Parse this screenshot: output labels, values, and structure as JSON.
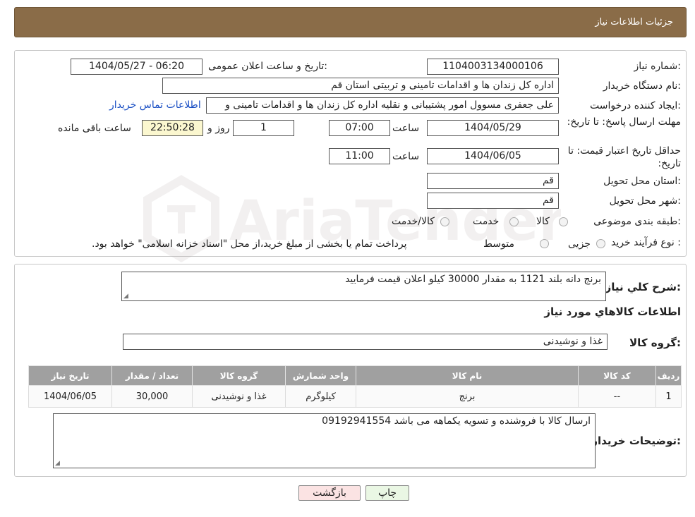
{
  "header": {
    "title": "جزئیات اطلاعات نیاز"
  },
  "form": {
    "need_number_label": "شماره نیاز:",
    "need_number": "1104003134000106",
    "announce_label": "تاریخ و ساعت اعلان عمومی:",
    "announce_value": "1404/05/27 - 06:20",
    "buyer_org_label": "نام دستگاه خریدار:",
    "buyer_org": "اداره کل زندان ها و اقدامات تامینی و تربیتی استان قم",
    "requester_label": "ایجاد کننده درخواست:",
    "requester": "علی جعفری مسوول امور پشتیبانی و نقلیه اداره کل زندان ها و اقدامات تامینی و",
    "contact_link": "اطلاعات تماس خریدار",
    "reply_deadline_label": "مهلت ارسال پاسخ: تا تاریخ:",
    "reply_date": "1404/05/29",
    "time_label": "ساعت",
    "reply_time": "07:00",
    "days_value": "1",
    "days_label": "روز و",
    "remaining_time": "22:50:28",
    "remaining_label": "ساعت باقی مانده",
    "validity_label": "حداقل تاریخ اعتبار قیمت: تا تاریخ:",
    "validity_date": "1404/06/05",
    "validity_time": "11:00",
    "province_label": "استان محل تحویل:",
    "province": "قم",
    "city_label": "شهر محل تحویل:",
    "city": "قم",
    "category_label": "طبقه بندی موضوعی:",
    "category_options": [
      "کالا",
      "خدمت",
      "کالا/خدمت"
    ],
    "process_label": "نوع فرآیند خرید :",
    "process_options": [
      "جزیی",
      "متوسط"
    ],
    "payment_note": "پرداخت تمام یا بخشی از مبلغ خرید،از محل \"اسناد خزانه اسلامی\" خواهد بود."
  },
  "details": {
    "description_label": "شرح کلي نياز:",
    "description": "برنج دانه بلند 1121 به مقدار 30000 کیلو اعلان قیمت فرمایید",
    "goods_info_title": "اطلاعات کالاهاي مورد نياز",
    "goods_group_label": "گروه کالا:",
    "goods_group": "غذا و نوشیدنی",
    "table": {
      "headers": [
        "رديف",
        "کد کالا",
        "نام کالا",
        "واحد شمارش",
        "گروه کالا",
        "تعداد / مقدار",
        "تاريخ نياز"
      ],
      "rows": [
        [
          "1",
          "--",
          "برنج",
          "کیلوگرم",
          "غذا و نوشیدنی",
          "30,000",
          "1404/06/05"
        ]
      ]
    },
    "buyer_notes_label": "توضيحات خريدار:",
    "buyer_notes": "ارسال کالا با فروشنده و تسویه یکماهه می باشد 09192941554"
  },
  "buttons": {
    "print": "چاپ",
    "back": "بازگشت"
  },
  "watermark": {
    "text": "AriaTender.neT"
  }
}
